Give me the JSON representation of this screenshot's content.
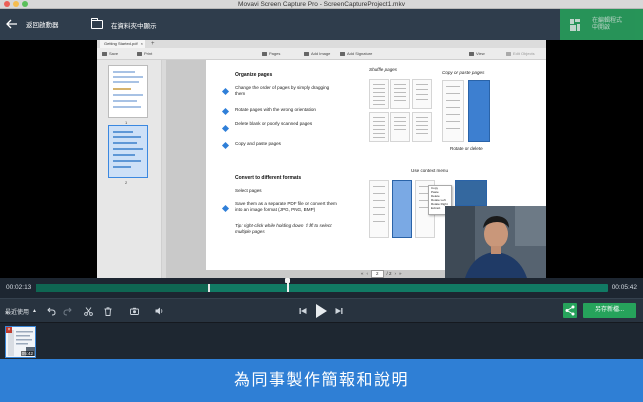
{
  "window": {
    "title": "Movavi Screen Capture Pro - ScreenCaptureProject1.mkv"
  },
  "header": {
    "back_label": "返回啟動器",
    "open_folder_label": "在資料夾中顯示",
    "edit_label_line1": "在編輯程式",
    "edit_label_line2": "中開啟"
  },
  "pdf": {
    "tab_label": "Getting Started.pdf",
    "tab_close": "×",
    "tab_add": "+",
    "toolbar": {
      "save": "Save",
      "print": "Print",
      "pages": "Pages",
      "add_image": "Add Image",
      "add_signature": "Add Signature",
      "view": "View",
      "edit_objects": "Edit Objects"
    },
    "thumbnails": [
      {
        "number": "1"
      },
      {
        "number": "2"
      }
    ],
    "page": {
      "heading_organize": "Organize pages",
      "item1": "Change the order of pages by simply dragging them",
      "item2": "Rotate pages with the wrong orientation",
      "item3": "Delete blank or poorly scanned pages",
      "item4": "Copy and paste pages",
      "heading_convert": "Convert to different formats",
      "select_pages": "Select pages",
      "item5": "Save them as a separate PDF file or convert them into an image format (JPG, PNG, BMP)",
      "tip": "Tip: right-click while holding down ⇧⌘ to select multiple pages",
      "label_shuffle": "Shuffle pages",
      "label_copy_paste": "Copy or paste pages",
      "label_rotate": "Rotate or delete",
      "label_context": "Use context menu",
      "context_items": [
        "Copy",
        "Paste",
        "Delete",
        "Rotate Left",
        "Rotate Right",
        "Extract"
      ]
    },
    "pager": {
      "prev": "«",
      "prev_single": "‹",
      "current": "2",
      "of": "/ 2",
      "next_single": "›",
      "next": "»"
    }
  },
  "timeline": {
    "current_time": "00:02:13",
    "total_time": "00:05:42",
    "played_fraction": 0.303,
    "playhead_fraction": 0.44
  },
  "controls": {
    "recent_label": "最近使用",
    "recent_caret": "▲",
    "save_label": "另存新檔..."
  },
  "recent": {
    "duration": "05:42",
    "delete_glyph": "×"
  },
  "banner": {
    "text": "為同事製作簡報和說明"
  },
  "colors": {
    "header_bg": "#2f3d4c",
    "accent_green": "#26a35b",
    "track_green": "#117a64",
    "banner_blue": "#2f7fd5"
  },
  "icons": [
    "back-arrow-icon",
    "folder-icon",
    "edit-icon",
    "undo-icon",
    "redo-icon",
    "scissors-icon",
    "trash-icon",
    "camera-icon",
    "volume-icon",
    "skip-back-icon",
    "play-icon",
    "skip-forward-icon",
    "share-icon"
  ]
}
